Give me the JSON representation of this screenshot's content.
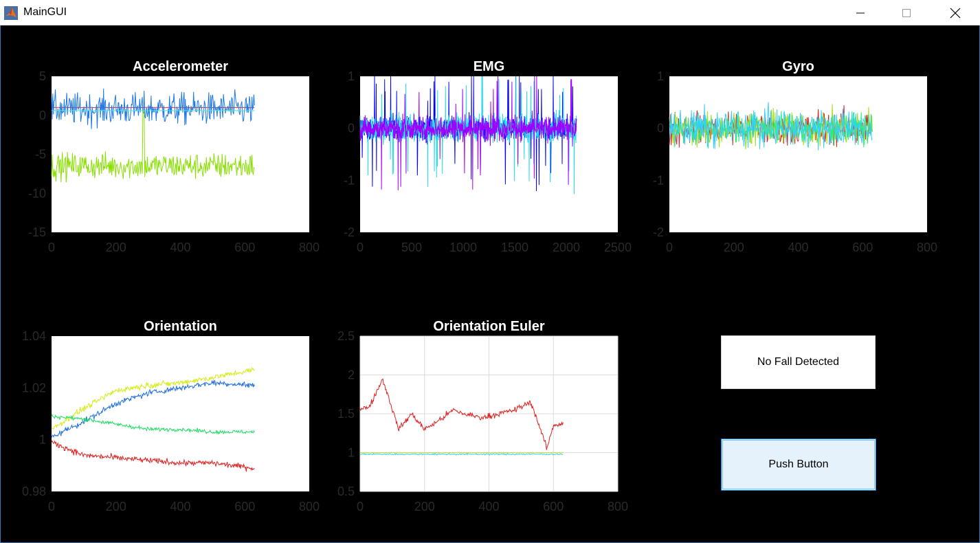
{
  "window": {
    "title": "MainGUI",
    "icon": "matlab-icon",
    "controls": [
      "minimize-icon",
      "maximize-icon",
      "close-icon"
    ]
  },
  "status": {
    "text": "No Fall Detected"
  },
  "button": {
    "label": "Push Button"
  },
  "chart_data": [
    {
      "type": "line",
      "title": "Accelerometer",
      "xlim": [
        0,
        800
      ],
      "ylim": [
        -15,
        5
      ],
      "xticks": [
        0,
        200,
        400,
        600,
        800
      ],
      "yticks": [
        5,
        0,
        -5,
        -10,
        -15
      ],
      "grid": false,
      "series": [
        {
          "color": "#e03030",
          "values": [
            [
              0,
              1.0
            ],
            [
              630,
              1.0
            ]
          ]
        },
        {
          "color": "#1f77e4",
          "values": [
            [
              0,
              0.8
            ],
            [
              630,
              0.8
            ]
          ]
        },
        {
          "color": "#4ee0e0",
          "values": [
            [
              0,
              0.6
            ],
            [
              630,
              0.6
            ]
          ]
        },
        {
          "color": "#88e000",
          "values": [
            [
              0,
              -6.5
            ],
            [
              630,
              -6.5
            ]
          ]
        }
      ]
    },
    {
      "type": "line",
      "title": "EMG",
      "xlim": [
        0,
        2500
      ],
      "ylim": [
        -2,
        1
      ],
      "xticks": [
        0,
        500,
        1000,
        1500,
        2000,
        2500
      ],
      "yticks": [
        1,
        0,
        -1,
        -2
      ],
      "grid": false,
      "series": [
        {
          "color": "#0000ff",
          "values": [
            [
              0,
              0.0
            ],
            [
              2100,
              0.0
            ]
          ]
        },
        {
          "color": "#22ddee",
          "values": [
            [
              0,
              0.0
            ],
            [
              2100,
              0.0
            ]
          ]
        },
        {
          "color": "#a000ff",
          "values": [
            [
              0,
              0.0
            ],
            [
              2100,
              0.0
            ]
          ]
        }
      ]
    },
    {
      "type": "line",
      "title": "Gyro",
      "xlim": [
        0,
        800
      ],
      "ylim": [
        -2,
        1
      ],
      "xticks": [
        0,
        200,
        400,
        600,
        800
      ],
      "yticks": [
        1,
        0,
        -1,
        -2
      ],
      "grid": false,
      "series": [
        {
          "color": "#e02020",
          "values": [
            [
              0,
              0.0
            ],
            [
              630,
              0.0
            ]
          ]
        },
        {
          "color": "#a0e010",
          "values": [
            [
              0,
              0.0
            ],
            [
              630,
              0.0
            ]
          ]
        },
        {
          "color": "#22ee88",
          "values": [
            [
              0,
              0.0
            ],
            [
              630,
              0.0
            ]
          ]
        },
        {
          "color": "#33d0ff",
          "values": [
            [
              0,
              0.0
            ],
            [
              630,
              0.0
            ]
          ]
        }
      ]
    },
    {
      "type": "line",
      "title": "Orientation",
      "xlim": [
        0,
        800
      ],
      "ylim": [
        0.98,
        1.04
      ],
      "xticks": [
        0,
        200,
        400,
        600,
        800
      ],
      "yticks": [
        1.04,
        1.02,
        1,
        0.98
      ],
      "ytick_labels": [
        "1.04",
        "1.02",
        "1",
        "0.98"
      ],
      "grid": false,
      "series": [
        {
          "color": "#d4ee10",
          "values": [
            [
              0,
              1.004
            ],
            [
              100,
              1.012
            ],
            [
              200,
              1.019
            ],
            [
              300,
              1.021
            ],
            [
              400,
              1.022
            ],
            [
              500,
              1.024
            ],
            [
              630,
              1.027
            ]
          ]
        },
        {
          "color": "#1f6fe0",
          "values": [
            [
              0,
              1.001
            ],
            [
              100,
              1.007
            ],
            [
              200,
              1.014
            ],
            [
              300,
              1.018
            ],
            [
              400,
              1.02
            ],
            [
              500,
              1.022
            ],
            [
              630,
              1.021
            ]
          ]
        },
        {
          "color": "#22dd66",
          "values": [
            [
              0,
              1.009
            ],
            [
              100,
              1.008
            ],
            [
              200,
              1.006
            ],
            [
              300,
              1.004
            ],
            [
              400,
              1.004
            ],
            [
              500,
              1.003
            ],
            [
              630,
              1.003
            ]
          ]
        },
        {
          "color": "#e02020",
          "values": [
            [
              0,
              0.999
            ],
            [
              100,
              0.994
            ],
            [
              200,
              0.993
            ],
            [
              300,
              0.992
            ],
            [
              400,
              0.991
            ],
            [
              500,
              0.991
            ],
            [
              630,
              0.989
            ]
          ]
        }
      ]
    },
    {
      "type": "line",
      "title": "Orientation Euler",
      "xlim": [
        0,
        800
      ],
      "ylim": [
        0.5,
        2.5
      ],
      "xticks": [
        0,
        200,
        400,
        600,
        800
      ],
      "yticks": [
        2.5,
        2,
        1.5,
        1,
        0.5
      ],
      "grid": true,
      "series": [
        {
          "color": "#e02020",
          "values": [
            [
              0,
              1.55
            ],
            [
              30,
              1.6
            ],
            [
              70,
              1.95
            ],
            [
              120,
              1.3
            ],
            [
              160,
              1.5
            ],
            [
              200,
              1.3
            ],
            [
              240,
              1.4
            ],
            [
              290,
              1.55
            ],
            [
              320,
              1.5
            ],
            [
              380,
              1.45
            ],
            [
              430,
              1.5
            ],
            [
              480,
              1.55
            ],
            [
              530,
              1.65
            ],
            [
              560,
              1.3
            ],
            [
              580,
              1.05
            ],
            [
              600,
              1.35
            ],
            [
              630,
              1.38
            ]
          ]
        },
        {
          "color": "#c8e020",
          "values": [
            [
              0,
              1.0
            ],
            [
              630,
              1.0
            ]
          ]
        },
        {
          "color": "#33d0ee",
          "values": [
            [
              0,
              0.98
            ],
            [
              630,
              0.98
            ]
          ]
        }
      ]
    }
  ]
}
